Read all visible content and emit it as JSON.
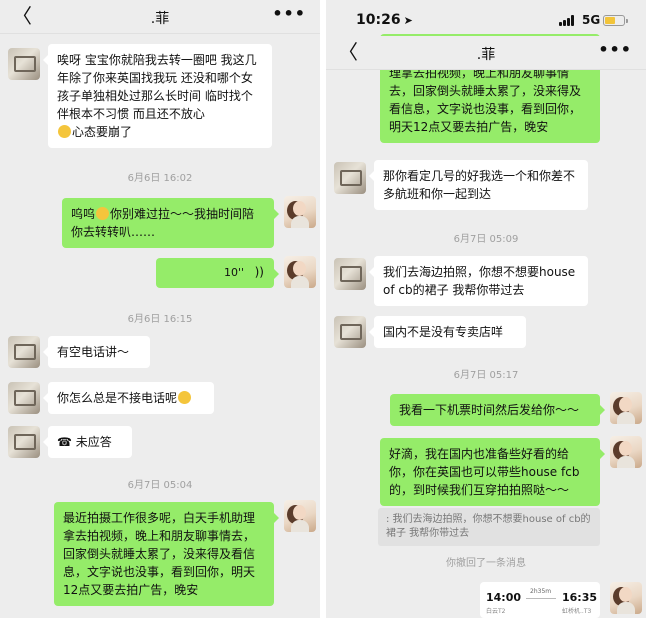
{
  "left": {
    "nav": {
      "back": "〈",
      "title": ".菲",
      "more": "•••"
    },
    "messages": [
      {
        "text": "唉呀 宝宝你就陪我去转一圈吧 我这几年除了你来英国找我玩 还没和哪个女孩子单独相处过那么长时间 临时找个伴根本不习惯 而且还不放心",
        "tail": "心态要崩了"
      },
      {
        "stamp": "6月6日 16:02"
      },
      {
        "pre": "呜呜",
        "text": "你别难过拉～～我抽时间陪你去转转叭……"
      },
      {
        "voice": "10''",
        "icon": "))"
      },
      {
        "stamp": "6月6日 16:15"
      },
      {
        "text": "有空电话讲～"
      },
      {
        "text": "你怎么总是不接电话呢"
      },
      {
        "icon": "☎",
        "text": "未应答"
      },
      {
        "stamp": "6月7日 05:04"
      },
      {
        "text": "最近拍摄工作很多呢，白天手机助理拿去拍视频，晚上和朋友聊事情去，回家倒头就睡太累了，没来得及看信息，文字说也没事，看到回你，明天12点又要去拍广告，晚安"
      }
    ]
  },
  "right": {
    "status": {
      "time": "10:26",
      "loc": "➤",
      "net": "5G"
    },
    "nav": {
      "back": "〈",
      "title": ".菲",
      "more": "•••"
    },
    "messages": [
      {
        "text": "理拿去拍视频，晚上和朋友聊事情去，回家倒头就睡太累了，没来得及看信息，文字说也没事，看到回你，明天12点又要去拍广告，晚安"
      },
      {
        "text": "那你看定几号的好我选一个和你差不多航班和你一起到达"
      },
      {
        "stamp": "6月7日 05:09"
      },
      {
        "text": "我们去海边拍照，你想不想要house of cb的裙子 我帮你带过去"
      },
      {
        "text": "国内不是没有专卖店咩"
      },
      {
        "stamp": "6月7日 05:17"
      },
      {
        "text": "我看一下机票时间然后发给你～～"
      },
      {
        "text": "好滴，我在国内也准备些好看的给你，你在英国也可以带些house fcb的，到时候我们互穿拍拍照哒～～"
      },
      {
        "quote": ": 我们去海边拍照，你想不想要house of cb的裙子 我帮你带过去"
      },
      {
        "recall": "你撤回了一条消息"
      },
      {
        "ticket": {
          "dep": "14:00",
          "dur": "2h35m",
          "arr": "16:35",
          "dep_sub": "白云T2",
          "arr_sub": "虹桥机..T3"
        }
      }
    ]
  }
}
